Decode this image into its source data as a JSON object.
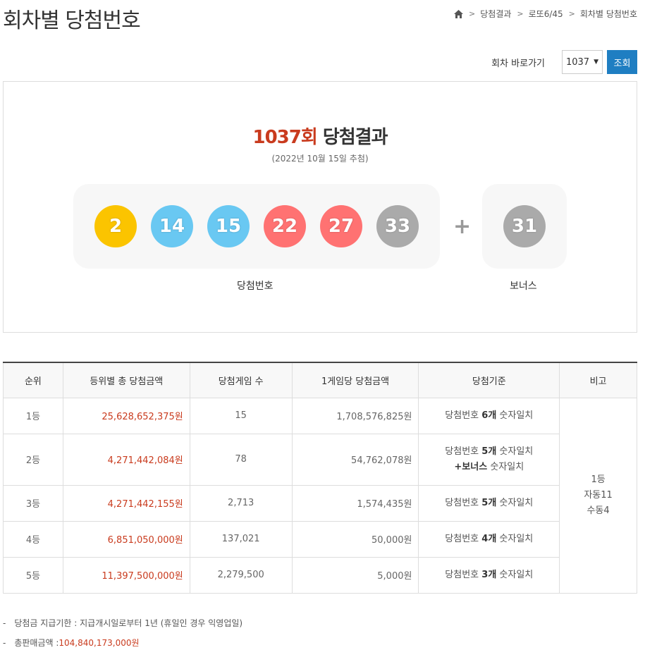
{
  "page": {
    "title": "회차별 당첨번호"
  },
  "breadcrumb": {
    "items": [
      "당첨결과",
      "로또6/45",
      "회차별 당첨번호"
    ]
  },
  "goto": {
    "label": "회차 바로가기",
    "selected_round": "1037",
    "button_label": "조회"
  },
  "result": {
    "round_label": "1037회",
    "title_suffix": " 당첨결과",
    "draw_date": "(2022년 10월 15일 추첨)",
    "numbers": [
      {
        "value": "2",
        "color": "#fbc400"
      },
      {
        "value": "14",
        "color": "#69c8f2"
      },
      {
        "value": "15",
        "color": "#69c8f2"
      },
      {
        "value": "22",
        "color": "#ff7272"
      },
      {
        "value": "27",
        "color": "#ff7272"
      },
      {
        "value": "33",
        "color": "#aaaaaa"
      }
    ],
    "plus": "+",
    "bonus": {
      "value": "31",
      "color": "#aaaaaa"
    },
    "numbers_label": "당첨번호",
    "bonus_label": "보너스"
  },
  "table": {
    "headers": [
      "순위",
      "등위별 총 당첨금액",
      "당첨게임 수",
      "1게임당 당첨금액",
      "당첨기준",
      "비고"
    ],
    "rows": [
      {
        "rank": "1등",
        "total": "25,628,652,375원",
        "games": "15",
        "per_game": "1,708,576,825원",
        "crit_pre": "당첨번호 ",
        "crit_bold": "6개",
        "crit_post": " 숫자일치",
        "crit_line2_bold": "",
        "crit_line2_post": ""
      },
      {
        "rank": "2등",
        "total": "4,271,442,084원",
        "games": "78",
        "per_game": "54,762,078원",
        "crit_pre": "당첨번호 ",
        "crit_bold": "5개",
        "crit_post": " 숫자일치",
        "crit_line2_bold": "+보너스",
        "crit_line2_post": " 숫자일치"
      },
      {
        "rank": "3등",
        "total": "4,271,442,155원",
        "games": "2,713",
        "per_game": "1,574,435원",
        "crit_pre": "당첨번호 ",
        "crit_bold": "5개",
        "crit_post": " 숫자일치",
        "crit_line2_bold": "",
        "crit_line2_post": ""
      },
      {
        "rank": "4등",
        "total": "6,851,050,000원",
        "games": "137,021",
        "per_game": "50,000원",
        "crit_pre": "당첨번호 ",
        "crit_bold": "4개",
        "crit_post": " 숫자일치",
        "crit_line2_bold": "",
        "crit_line2_post": ""
      },
      {
        "rank": "5등",
        "total": "11,397,500,000원",
        "games": "2,279,500",
        "per_game": "5,000원",
        "crit_pre": "당첨번호 ",
        "crit_bold": "3개",
        "crit_post": " 숫자일치",
        "crit_line2_bold": "",
        "crit_line2_post": ""
      }
    ],
    "note": [
      "1등",
      "자동11",
      "수동4"
    ]
  },
  "footnotes": {
    "deadline": "당첨금 지급기한 : 지급개시일로부터 1년 (휴일인 경우 익영업일)",
    "total_sales_label": "총판매금액 : ",
    "total_sales_value": "104,840,173,000원"
  },
  "colors": {
    "accent_red": "#c93b1e",
    "button_blue": "#1f7ec2"
  }
}
